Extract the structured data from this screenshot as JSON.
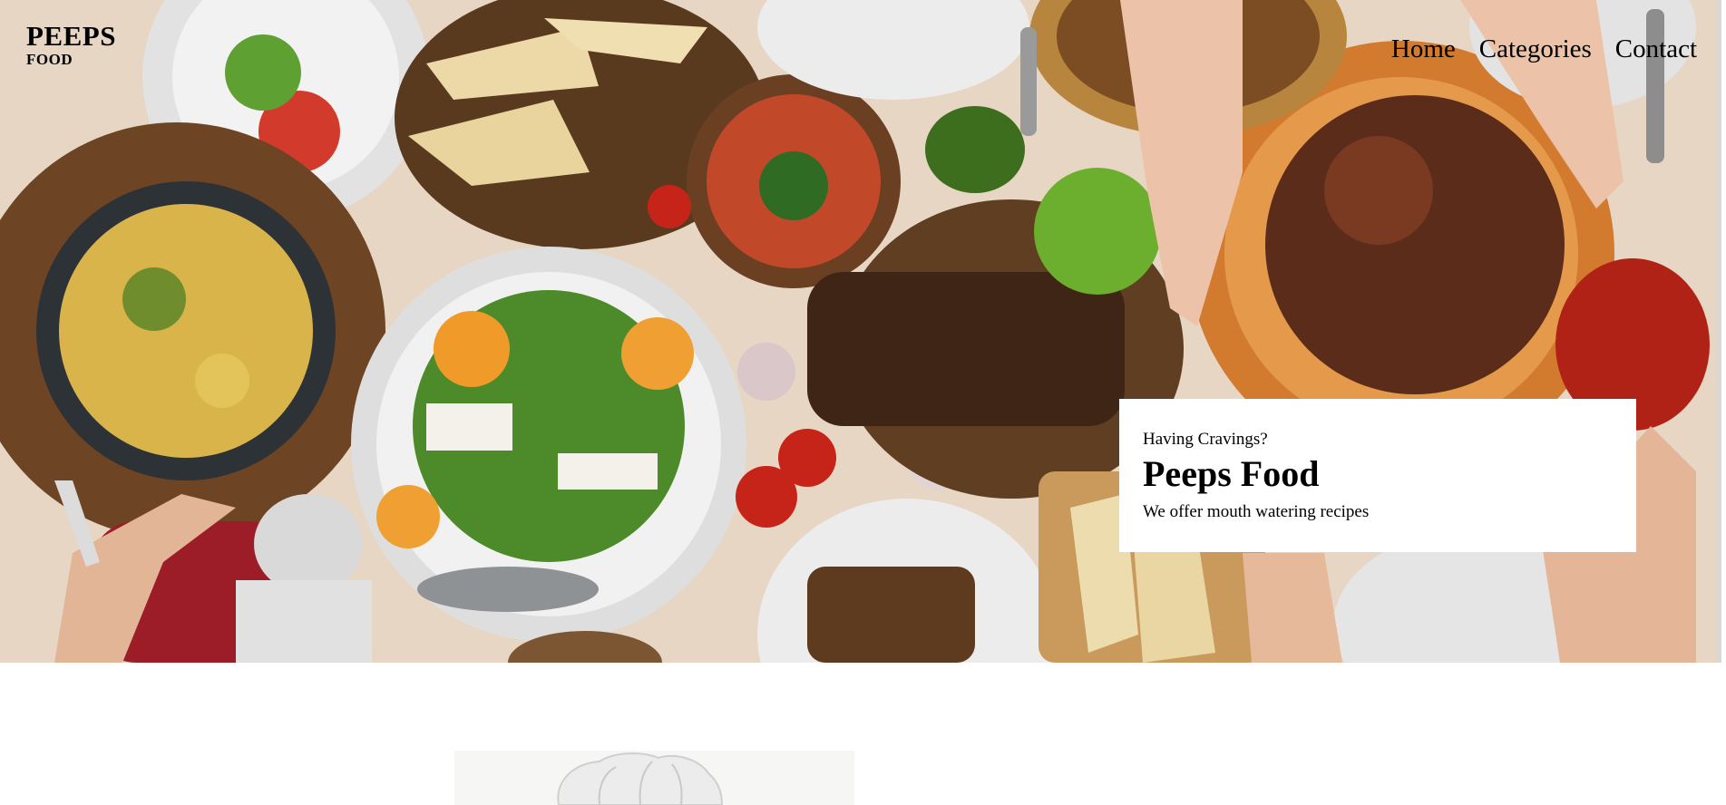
{
  "brand": {
    "name": "PEEPS",
    "sub": "FOOD"
  },
  "nav": {
    "items": [
      {
        "label": "Home"
      },
      {
        "label": "Categories"
      },
      {
        "label": "Contact"
      }
    ]
  },
  "hero": {
    "eyebrow": "Having Cravings?",
    "title": "Peeps Food",
    "tagline": "We offer mouth watering recipes"
  },
  "icons": {
    "hero_image": "food-table-photo",
    "chef_image": "chef-hat-photo"
  },
  "colors": {
    "hero_background": "#e7d8c6",
    "card_background": "#ffffff",
    "text": "#000000"
  }
}
